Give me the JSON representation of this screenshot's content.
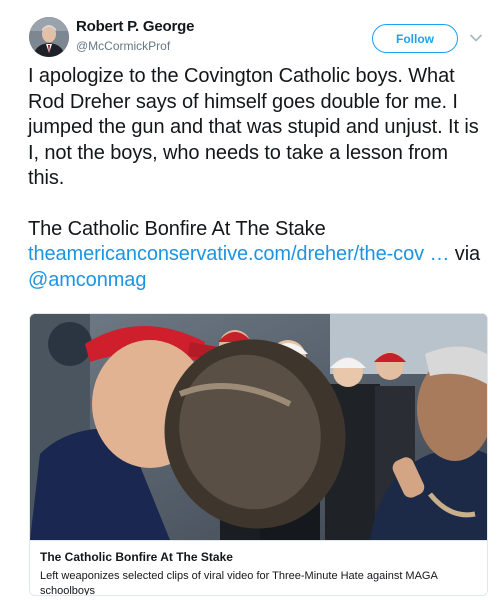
{
  "author": {
    "name": "Robert P. George",
    "handle": "@McCormickProf"
  },
  "follow_label": "Follow",
  "icons": {
    "avatar": "avatar-portrait",
    "caret": "chevron-down-icon"
  },
  "tweet": {
    "paragraph1": "I apologize to the Covington Catholic boys. What Rod Dreher says of himself goes double for me. I jumped the gun and that was stupid and unjust. It is I, not the boys, who needs to take a lesson from this.",
    "paragraph2_text": "The Catholic Bonfire At The Stake ",
    "link": "theamericanconservative.com/dreher/the-cov …",
    "via": " via ",
    "mention": "@amconmag"
  },
  "card": {
    "title": "The Catholic Bonfire At The Stake",
    "description": "Left weaponizes selected clips of viral video for Three-Minute Hate against MAGA schoolboys"
  },
  "colors": {
    "accent": "#1da1f2",
    "link": "#1b95e0",
    "text": "#14171a",
    "secondary": "#657786",
    "border": "#e1e8ed"
  }
}
